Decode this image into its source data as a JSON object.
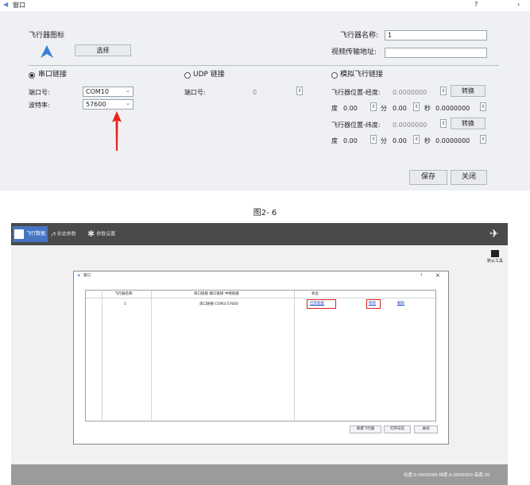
{
  "dialog1": {
    "title": "窗口",
    "help": "?",
    "more": "›",
    "aircraft_icon_label": "飞行器图标",
    "select_button": "选择",
    "aircraft_name_label": "飞行器名称:",
    "aircraft_name_value": "1",
    "video_address_label": "视频传输地址:",
    "video_address_value": "",
    "serial": {
      "radio_label": "串口链接",
      "port_label": "端口号:",
      "port_value": "COM10",
      "baud_label": "波特率:",
      "baud_value": "57600"
    },
    "udp": {
      "radio_label": "UDP 链接",
      "port_label": "端口号:",
      "port_value": "0"
    },
    "sim": {
      "radio_label": "模拟飞行链接",
      "lon_label": "飞行器位置-经度:",
      "lon_value": "0.0000000",
      "lat_label": "飞行器位置-纬度:",
      "lat_value": "0.0000000",
      "convert_button": "转换",
      "deg_label": "度",
      "min_label": "分",
      "sec_label": "秒",
      "deg_value": "0.00",
      "min_value": "0.00",
      "sec_value": "0.0000000"
    },
    "save_button": "保存",
    "close_button": "关闭"
  },
  "caption": "图2- 6",
  "app": {
    "tabs": [
      "飞行数据",
      "状态参数",
      "参数设置"
    ],
    "tool_button": "默认工具",
    "status_text": "经度:0.0000000 纬度:0.0000000 高度:20",
    "dialog": {
      "title": "窗口",
      "help": "?",
      "close": "×",
      "columns": [
        "飞行器名称",
        "串口链接  端口链接  中继链接",
        "状态"
      ],
      "rows": [
        {
          "name": "1",
          "link": "串口链接:COM3:57600",
          "status": "打开链接",
          "edit": "修改",
          "delete": "删除"
        }
      ],
      "buttons": [
        "新建飞行器",
        "打开日志",
        "关闭"
      ]
    }
  }
}
